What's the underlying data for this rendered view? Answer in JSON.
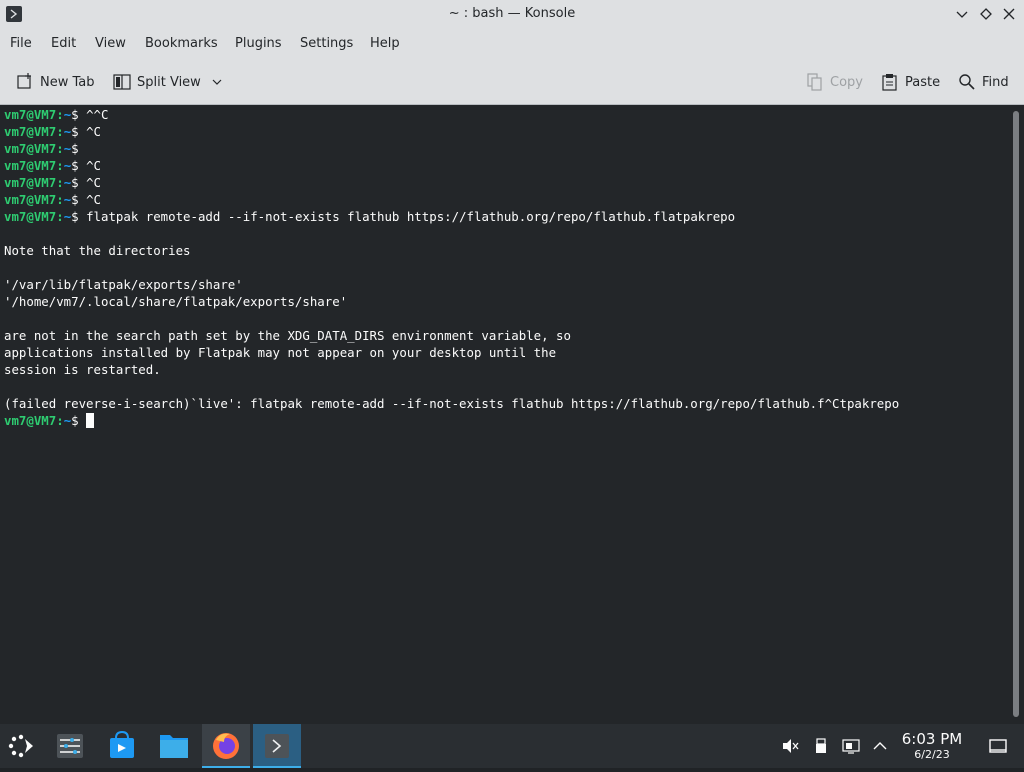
{
  "window": {
    "title": "~ : bash — Konsole"
  },
  "menu": [
    "File",
    "Edit",
    "View",
    "Bookmarks",
    "Plugins",
    "Settings",
    "Help"
  ],
  "toolbar": {
    "new_tab": "New Tab",
    "split_view": "Split View",
    "copy": "Copy",
    "paste": "Paste",
    "find": "Find"
  },
  "terminal": {
    "prompt_user": "vm7@VM7",
    "prompt_sep": ":",
    "prompt_dir": "~",
    "prompt_end": "$ ",
    "lines": [
      {
        "type": "cmd",
        "text": "^^C"
      },
      {
        "type": "cmd",
        "text": "^C"
      },
      {
        "type": "cmd",
        "text": ""
      },
      {
        "type": "cmd",
        "text": "^C"
      },
      {
        "type": "cmd",
        "text": "^C"
      },
      {
        "type": "cmd",
        "text": "^C"
      },
      {
        "type": "cmd",
        "text": "flatpak remote-add --if-not-exists flathub https://flathub.org/repo/flathub.flatpakrepo"
      },
      {
        "type": "out",
        "text": ""
      },
      {
        "type": "out",
        "text": "Note that the directories"
      },
      {
        "type": "out",
        "text": ""
      },
      {
        "type": "out",
        "text": "'/var/lib/flatpak/exports/share'"
      },
      {
        "type": "out",
        "text": "'/home/vm7/.local/share/flatpak/exports/share'"
      },
      {
        "type": "out",
        "text": ""
      },
      {
        "type": "out",
        "text": "are not in the search path set by the XDG_DATA_DIRS environment variable, so"
      },
      {
        "type": "out",
        "text": "applications installed by Flatpak may not appear on your desktop until the"
      },
      {
        "type": "out",
        "text": "session is restarted."
      },
      {
        "type": "out",
        "text": ""
      },
      {
        "type": "out",
        "text": "(failed reverse-i-search)`live': flatpak remote-add --if-not-exists flathub https://flathub.org/repo/flathub.f^Ctpakrepo"
      },
      {
        "type": "cursor",
        "text": ""
      }
    ]
  },
  "clock": {
    "time": "6:03 PM",
    "date": "6/2/23"
  },
  "colors": {
    "terminal_bg": "#232629",
    "prompt_green": "#2ecc71",
    "accent_blue": "#3daee9"
  }
}
